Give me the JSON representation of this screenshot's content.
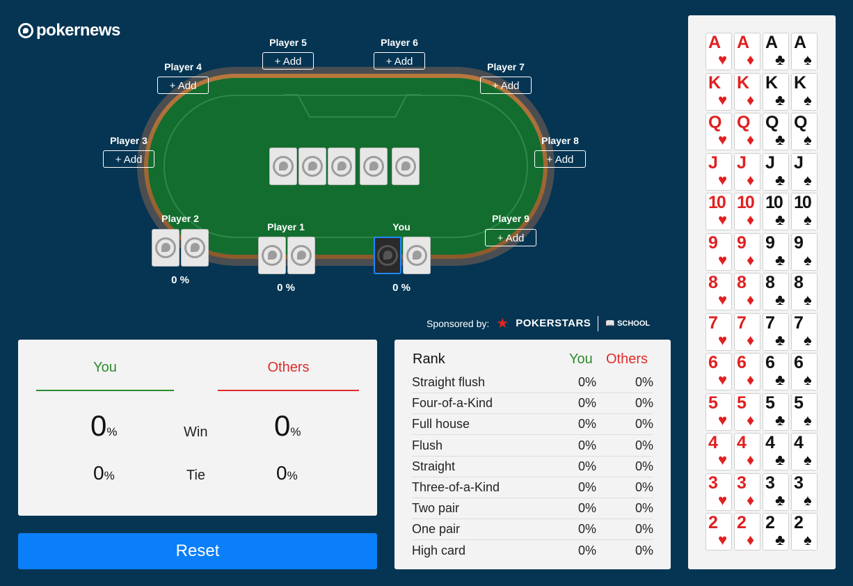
{
  "brand": {
    "logo_text": "pokernews"
  },
  "colors": {
    "background": "#053553",
    "felt": "#136d2f",
    "you": "#2e8b2e",
    "others": "#e02b2b",
    "accent": "#0b7ef9"
  },
  "seats": [
    {
      "label": "Player 1",
      "pct": "0 %"
    },
    {
      "label": "Player 2",
      "pct": "0 %"
    },
    {
      "label": "Player 3",
      "add": "+ Add"
    },
    {
      "label": "Player 4",
      "add": "+ Add"
    },
    {
      "label": "Player 5",
      "add": "+ Add"
    },
    {
      "label": "Player 6",
      "add": "+ Add"
    },
    {
      "label": "Player 7",
      "add": "+ Add"
    },
    {
      "label": "Player 8",
      "add": "+ Add"
    },
    {
      "label": "Player 9",
      "add": "+ Add"
    },
    {
      "label": "You",
      "pct": "0 %"
    }
  ],
  "sponsor": {
    "label": "Sponsored by:",
    "brand": "POKERSTARS",
    "sub": "SCHOOL"
  },
  "result": {
    "you_label": "You",
    "others_label": "Others",
    "win_label": "Win",
    "tie_label": "Tie",
    "you_win": "0",
    "you_tie": "0",
    "others_win": "0",
    "others_tie": "0",
    "pct_sign": "%"
  },
  "reset_label": "Reset",
  "ranks": {
    "header": {
      "rank": "Rank",
      "you": "You",
      "others": "Others"
    },
    "rows": [
      {
        "name": "Straight flush",
        "you": "0%",
        "others": "0%"
      },
      {
        "name": "Four-of-a-Kind",
        "you": "0%",
        "others": "0%"
      },
      {
        "name": "Full house",
        "you": "0%",
        "others": "0%"
      },
      {
        "name": "Flush",
        "you": "0%",
        "others": "0%"
      },
      {
        "name": "Straight",
        "you": "0%",
        "others": "0%"
      },
      {
        "name": "Three-of-a-Kind",
        "you": "0%",
        "others": "0%"
      },
      {
        "name": "Two pair",
        "you": "0%",
        "others": "0%"
      },
      {
        "name": "One pair",
        "you": "0%",
        "others": "0%"
      },
      {
        "name": "High card",
        "you": "0%",
        "others": "0%"
      }
    ]
  },
  "deck": {
    "ranks": [
      "A",
      "K",
      "Q",
      "J",
      "10",
      "9",
      "8",
      "7",
      "6",
      "5",
      "4",
      "3",
      "2"
    ],
    "suits": [
      {
        "name": "hearts",
        "glyph": "♥",
        "color": "#e02020"
      },
      {
        "name": "diamonds",
        "glyph": "♦",
        "color": "#e02020"
      },
      {
        "name": "clubs",
        "glyph": "♣",
        "color": "#111111"
      },
      {
        "name": "spades",
        "glyph": "♠",
        "color": "#111111"
      }
    ]
  }
}
